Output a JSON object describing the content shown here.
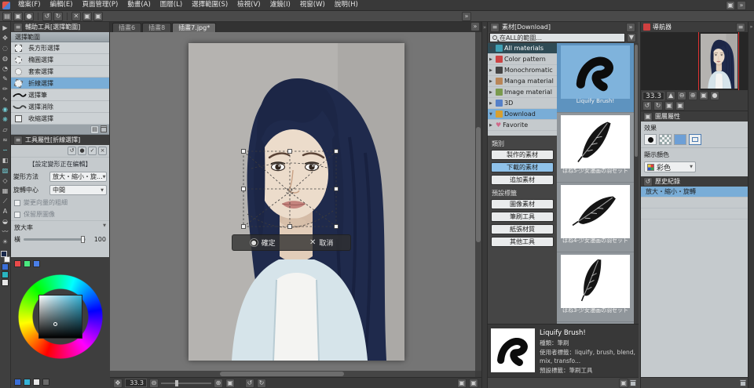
{
  "menu": {
    "items": [
      "檔案(F)",
      "編輯(E)",
      "頁面管理(P)",
      "動畫(A)",
      "圖層(L)",
      "選擇範圍(S)",
      "檢視(V)",
      "濾鏡(I)",
      "視窗(W)",
      "說明(H)"
    ]
  },
  "subtool": {
    "tab": "輔助工具[選擇範圍]",
    "group": "選擇範圍",
    "items": [
      "長方形選擇",
      "橢圓選擇",
      "套索選擇",
      "折線選擇",
      "選擇筆",
      "選擇消除",
      "收縮選擇"
    ],
    "selected": "折線選擇"
  },
  "tool_property": {
    "tab": "工具屬性[折線選擇]",
    "notice": "【設定變形正在編輯】",
    "row1_label": "變形方法",
    "row1_value": "放大・縮小・旋...",
    "row2_label": "旋轉中心",
    "row2_value": "中間",
    "check1": "變更向量的粗細",
    "check2": "保留原圖像",
    "scale_label": "放大率",
    "scale_axis": "橫",
    "scale_value": "100"
  },
  "canvas": {
    "tabs": [
      "插畫6",
      "插畫8",
      "插畫7.jpg*"
    ],
    "active_tab": "插畫7.jpg*",
    "confirm": "確定",
    "cancel": "取消",
    "zoom": "33.3"
  },
  "materials": {
    "tab": "素材[Download]",
    "search_text": "在ALL的範圍...",
    "tree": [
      "All materials",
      "Color pattern",
      "Monochromatic",
      "Manga material",
      "Image material",
      "3D",
      "Download",
      "Favorite"
    ],
    "category_label": "類別",
    "categories": [
      "製作的素材",
      "下載的素材",
      "追加素材"
    ],
    "preset_label": "預設標籤",
    "preset_tags": [
      "圖像素材",
      "筆刷工具",
      "紙張材質",
      "其他工具"
    ],
    "items": [
      {
        "name": "Liquify Brush!"
      },
      {
        "name": "はね5-少女漫画の羽セット"
      },
      {
        "name": "はね4-少女漫画の羽セット"
      },
      {
        "name": "はね3-少女漫画の羽セット"
      }
    ],
    "detail": {
      "name": "Liquify Brush!",
      "type": "種類：筆刷",
      "user_tags": "使用者標籤：liquify, brush, blend, mix, transfo...",
      "preset_tags": "預設標籤：筆刷工具"
    }
  },
  "navigator": {
    "title": "導航器",
    "zoom": "33.3"
  },
  "layer_property": {
    "tab": "圖層屬性",
    "effect_label": "效果",
    "display_color_label": "顯示顏色",
    "color_mode": "彩色"
  },
  "history": {
    "tab": "歷史紀錄",
    "selected_item": "放大・縮小・旋轉"
  },
  "icons": {
    "menu": "≡",
    "more": "»",
    "close": "×",
    "tri_right": "▶",
    "tri_down": "▼",
    "caret": "▼",
    "up": "▲",
    "down": "▼",
    "heart": "♥",
    "plus": "+",
    "minus": "−",
    "zoom_in": "⊕",
    "zoom_out": "⊖",
    "rotate_left": "↺",
    "rotate_right": "↻",
    "page": "▤",
    "box": "▣",
    "dot": "●",
    "cross": "✕",
    "check": "✓"
  }
}
